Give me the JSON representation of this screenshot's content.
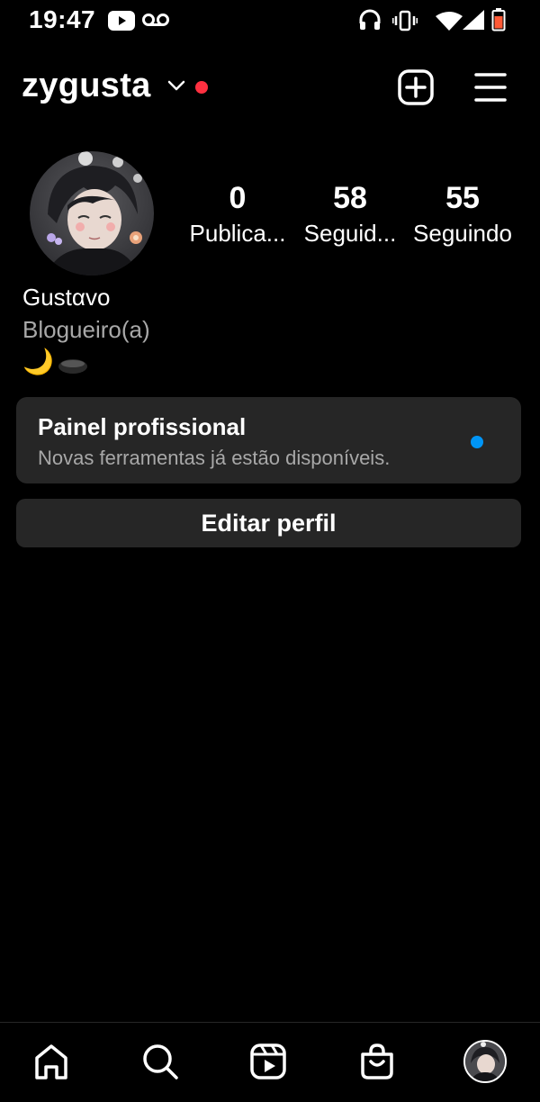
{
  "status_bar": {
    "time": "19:47",
    "icons": [
      "youtube-icon",
      "voicemail-icon",
      "headphones-icon",
      "vibrate-icon",
      "wifi-icon",
      "signal-icon",
      "battery-icon"
    ]
  },
  "header": {
    "username": "zygusta",
    "icons": [
      "chevron-down-icon",
      "new-post-icon",
      "menu-icon"
    ],
    "notification_color": "#ff3040"
  },
  "profile": {
    "stats": [
      {
        "value": "0",
        "label": "Publica..."
      },
      {
        "value": "58",
        "label": "Seguid..."
      },
      {
        "value": "55",
        "label": "Seguindo"
      }
    ],
    "display_name": "Gustαvo",
    "category": "Blogueiro(a)",
    "bio_emoji": "🌙"
  },
  "pro_panel": {
    "title": "Painel profissional",
    "subtitle": "Novas ferramentas já estão disponíveis.",
    "dot_color": "#0095f6"
  },
  "edit_profile_label": "Editar perfil",
  "bottom_nav": {
    "items": [
      "home-icon",
      "search-icon",
      "reels-icon",
      "shop-icon",
      "profile-avatar"
    ]
  },
  "colors": {
    "background": "#000000",
    "surface": "#262626",
    "secondary_text": "#a8a8a8"
  }
}
